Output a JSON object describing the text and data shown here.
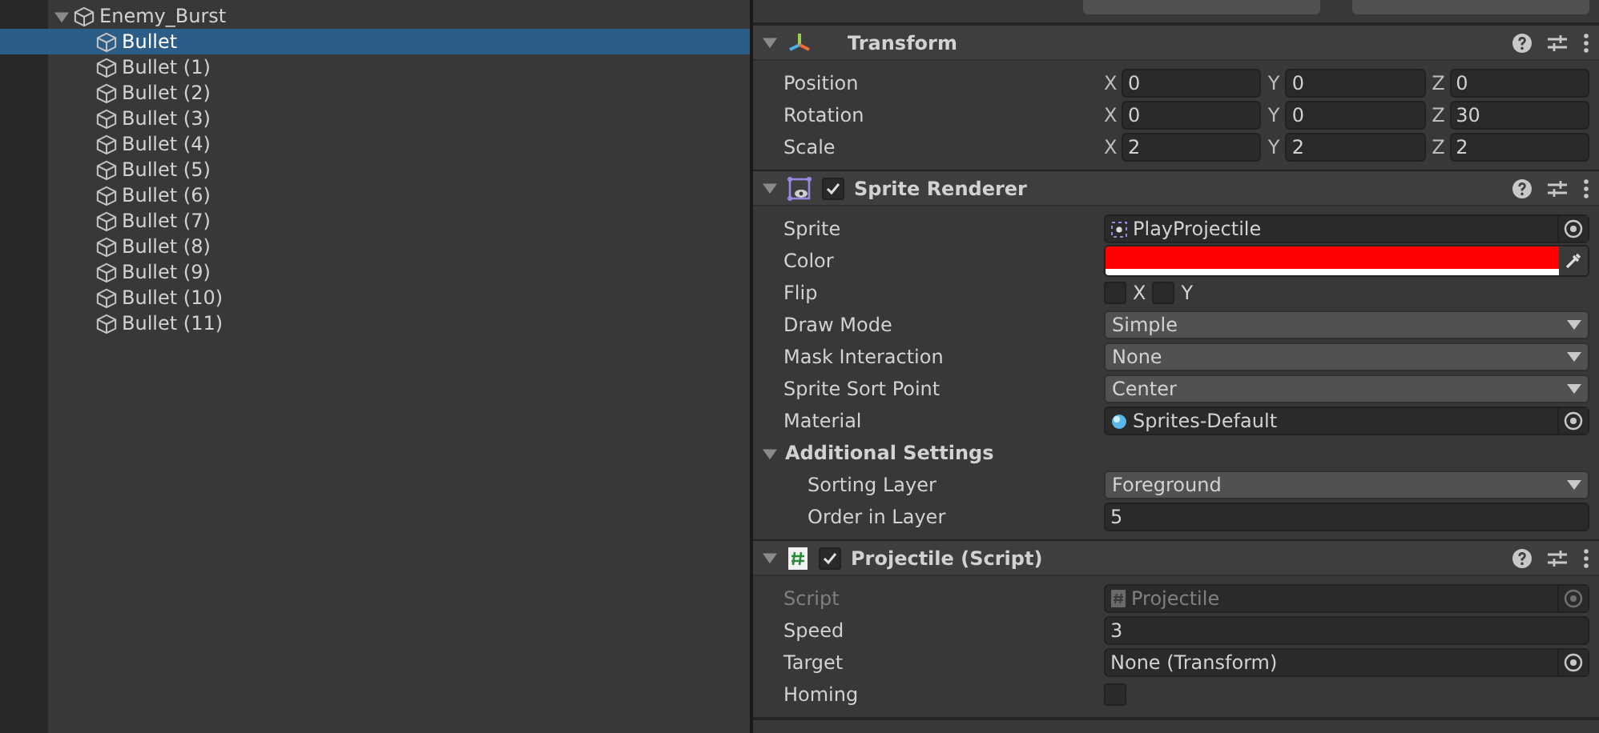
{
  "hierarchy": {
    "items": [
      {
        "name": "Enemy_Burst",
        "expanded": true,
        "selected": false,
        "children": [
          {
            "name": "Bullet",
            "selected": true
          },
          {
            "name": "Bullet (1)",
            "selected": false
          },
          {
            "name": "Bullet (2)",
            "selected": false
          },
          {
            "name": "Bullet (3)",
            "selected": false
          },
          {
            "name": "Bullet (4)",
            "selected": false
          },
          {
            "name": "Bullet (5)",
            "selected": false
          },
          {
            "name": "Bullet (6)",
            "selected": false
          },
          {
            "name": "Bullet (7)",
            "selected": false
          },
          {
            "name": "Bullet (8)",
            "selected": false
          },
          {
            "name": "Bullet (9)",
            "selected": false
          },
          {
            "name": "Bullet (10)",
            "selected": false
          },
          {
            "name": "Bullet (11)",
            "selected": false
          }
        ]
      }
    ]
  },
  "inspector": {
    "components": [
      {
        "kind": "transform",
        "title": "Transform",
        "expanded": true,
        "rows": [
          {
            "kind": "vector3",
            "label": "Position",
            "axes": [
              {
                "axis": "X",
                "value": "0"
              },
              {
                "axis": "Y",
                "value": "0"
              },
              {
                "axis": "Z",
                "value": "0"
              }
            ]
          },
          {
            "kind": "vector3",
            "label": "Rotation",
            "axes": [
              {
                "axis": "X",
                "value": "0"
              },
              {
                "axis": "Y",
                "value": "0"
              },
              {
                "axis": "Z",
                "value": "30"
              }
            ]
          },
          {
            "kind": "vector3",
            "label": "Scale",
            "axes": [
              {
                "axis": "X",
                "value": "2"
              },
              {
                "axis": "Y",
                "value": "2"
              },
              {
                "axis": "Z",
                "value": "2"
              }
            ]
          }
        ]
      },
      {
        "kind": "sprite_renderer",
        "title": "Sprite Renderer",
        "expanded": true,
        "enabled": true,
        "rows": [
          {
            "kind": "sprite_object",
            "label": "Sprite",
            "value": "PlayProjectile"
          },
          {
            "kind": "color",
            "label": "Color",
            "color": "#ff0000"
          },
          {
            "kind": "flip",
            "label": "Flip",
            "options": [
              {
                "label": "X",
                "checked": false
              },
              {
                "label": "Y",
                "checked": false
              }
            ]
          },
          {
            "kind": "dropdown",
            "label": "Draw Mode",
            "value": "Simple"
          },
          {
            "kind": "dropdown",
            "label": "Mask Interaction",
            "value": "None"
          },
          {
            "kind": "dropdown",
            "label": "Sprite Sort Point",
            "value": "Center"
          },
          {
            "kind": "material_object",
            "label": "Material",
            "value": "Sprites-Default"
          },
          {
            "kind": "section",
            "label": "Additional Settings",
            "expanded": true,
            "rows": [
              {
                "kind": "dropdown",
                "label": "Sorting Layer",
                "value": "Foreground"
              },
              {
                "kind": "number",
                "label": "Order in Layer",
                "value": "5"
              }
            ]
          }
        ]
      },
      {
        "kind": "script",
        "title": "Projectile (Script)",
        "expanded": true,
        "enabled": true,
        "rows": [
          {
            "kind": "script_object",
            "label": "Script",
            "value": "Projectile",
            "disabled": true
          },
          {
            "kind": "number",
            "label": "Speed",
            "value": "3"
          },
          {
            "kind": "object",
            "label": "Target",
            "value": "None (Transform)"
          },
          {
            "kind": "checkbox",
            "label": "Homing",
            "checked": false
          }
        ]
      }
    ]
  }
}
